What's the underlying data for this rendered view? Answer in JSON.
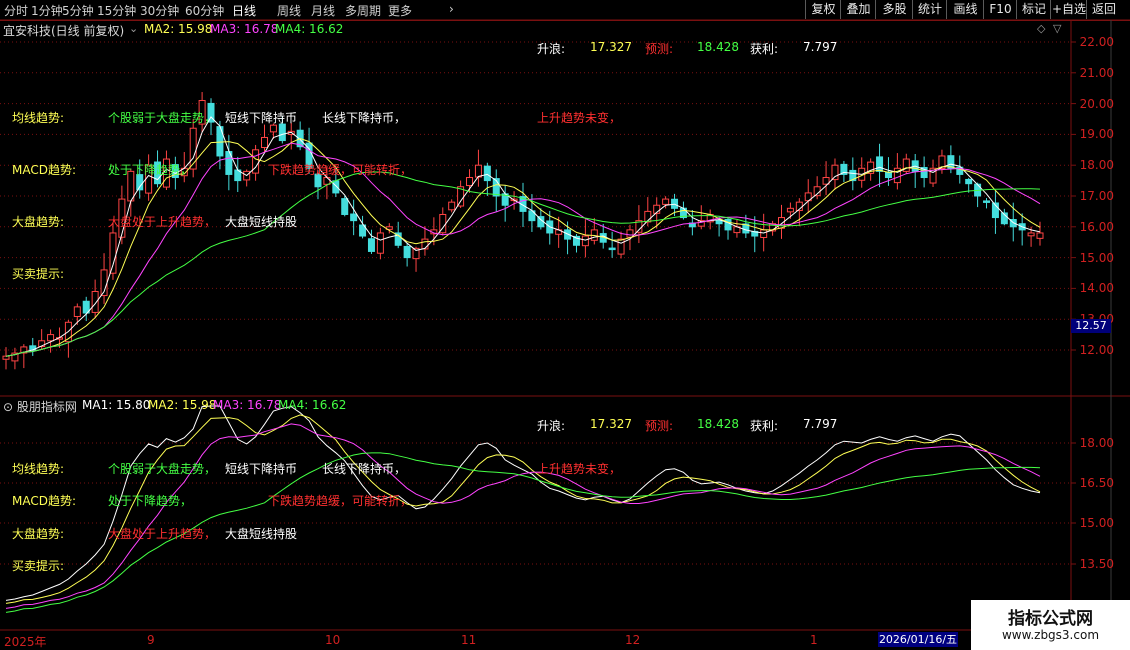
{
  "toolbar": {
    "periods": [
      "分时",
      "1分钟",
      "5分钟",
      "15分钟",
      "30分钟",
      "60分钟",
      "日线",
      "周线",
      "月线",
      "多周期",
      "更多"
    ],
    "active_period": "日线",
    "more_arrow": "chevron-right",
    "right_buttons": [
      "复权",
      "叠加",
      "多股",
      "统计",
      "画线",
      "F10",
      "标记",
      "+自选",
      "返回"
    ]
  },
  "main_panel": {
    "title": "宜安科技(日线 前复权)",
    "ma": [
      {
        "label": "MA2: 15.98",
        "color": "#ffff55"
      },
      {
        "label": "MA3: 16.78",
        "color": "#ff44ff"
      },
      {
        "label": "MA4: 16.62",
        "color": "#44ff44"
      }
    ],
    "info": {
      "rise_label": "升浪:",
      "rise_value": "17.327",
      "forecast_label": "预测:",
      "forecast_value": "18.428",
      "profit_label": "获利:",
      "profit_value": "7.797"
    },
    "annotations": {
      "trend_label": "均线趋势:",
      "trend_1": "个股弱于大盘走势，",
      "trend_2": "短线下降持币",
      "trend_3": "长线下降持币，",
      "trend_4": "上升趋势未变，",
      "macd_label": "MACD趋势:",
      "macd_1": "处于下降趋势，",
      "macd_2": "下跌趋势趋缓，可能转折，",
      "market_label": "大盘趋势:",
      "market_1": "大盘处于上升趋势，",
      "market_2": "大盘短线持股",
      "trade_label": "买卖提示:"
    },
    "y_ticks": [
      "22.00",
      "21.00",
      "20.00",
      "19.00",
      "18.00",
      "17.00",
      "16.00",
      "15.00",
      "14.00",
      "13.00",
      "12.00"
    ],
    "current_price": "12.57"
  },
  "indicator_panel": {
    "title": "股朋指标网",
    "ma": [
      {
        "label": "MA1: 15.80",
        "color": "#ffffff"
      },
      {
        "label": "MA2: 15.98",
        "color": "#ffff55"
      },
      {
        "label": "MA3: 16.78",
        "color": "#ff44ff"
      },
      {
        "label": "MA4: 16.62",
        "color": "#44ff44"
      }
    ],
    "info": {
      "rise_label": "升浪:",
      "rise_value": "17.327",
      "forecast_label": "预测:",
      "forecast_value": "18.428",
      "profit_label": "获利:",
      "profit_value": "7.797"
    },
    "annotations": {
      "trend_label": "均线趋势:",
      "trend_1": "个股弱于大盘走势，",
      "trend_2": "短线下降持币",
      "trend_3": "长线下降持币，",
      "trend_4": "上升趋势未变，",
      "macd_label": "MACD趋势:",
      "macd_1": "处于下降趋势，",
      "macd_2": "下跌趋势趋缓，可能转折，",
      "market_label": "大盘趋势:",
      "market_1": "大盘处于上升趋势，",
      "market_2": "大盘短线持股",
      "trade_label": "买卖提示:"
    },
    "y_ticks": [
      "18.00",
      "16.50",
      "15.00",
      "13.50"
    ]
  },
  "x_axis": {
    "labels": [
      "2025年",
      "9",
      "10",
      "11",
      "12",
      "1"
    ],
    "selected_date": "2026/01/16/五"
  },
  "watermark": {
    "line1": "指标公式网",
    "line2": "www.zbgs3.com"
  },
  "colors": {
    "up": "#ff4444",
    "down": "#44dddd",
    "grid": "#7a1010",
    "axis_text": "#d02020"
  },
  "chart_data": {
    "type": "candlestick",
    "closes": [
      11.8,
      11.9,
      12.1,
      12.0,
      12.3,
      12.5,
      12.4,
      12.9,
      13.4,
      13.2,
      13.9,
      14.6,
      15.8,
      16.9,
      17.8,
      17.2,
      18.0,
      17.4,
      18.2,
      17.6,
      17.9,
      19.2,
      20.1,
      19.4,
      18.3,
      17.7,
      17.5,
      17.8,
      18.5,
      18.9,
      19.3,
      18.8,
      19.1,
      18.6,
      17.9,
      17.3,
      17.6,
      17.1,
      16.4,
      16.2,
      15.7,
      15.2,
      15.8,
      16.0,
      15.4,
      15.0,
      15.3,
      15.6,
      15.9,
      16.4,
      16.8,
      17.3,
      17.6,
      18.0,
      17.5,
      17.0,
      16.7,
      16.9,
      16.5,
      16.2,
      16.0,
      15.8,
      15.9,
      15.6,
      15.4,
      15.7,
      15.9,
      15.5,
      15.3,
      15.6,
      15.9,
      16.2,
      16.5,
      16.7,
      16.9,
      16.6,
      16.3,
      16.0,
      16.2,
      16.4,
      16.1,
      15.9,
      16.0,
      15.8,
      15.7,
      15.9,
      16.1,
      16.3,
      16.6,
      16.8,
      17.1,
      17.3,
      17.6,
      18.0,
      17.7,
      17.5,
      17.9,
      18.1,
      17.8,
      17.6,
      17.9,
      18.2,
      17.8,
      17.6,
      17.9,
      18.3,
      17.9,
      17.7,
      17.4,
      17.0,
      16.8,
      16.3,
      16.1,
      16.0,
      15.9,
      15.8,
      15.8
    ]
  }
}
